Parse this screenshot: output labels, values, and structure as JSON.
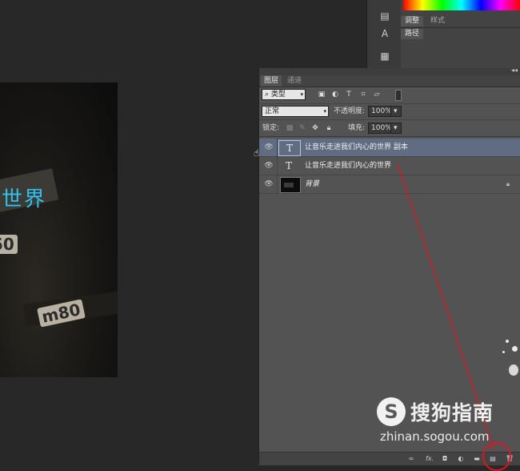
{
  "canvas": {
    "text": "世界",
    "tag_left": "50",
    "tag_right": "m80"
  },
  "top_panel": {
    "tabs": [
      "调整",
      "样式"
    ],
    "path_tab": "路径"
  },
  "layers_panel": {
    "tabs": [
      "图层",
      "通道"
    ],
    "filter": {
      "label": "类型",
      "icons": [
        "image-filter-icon",
        "adjustment-filter-icon",
        "type-filter-icon",
        "shape-filter-icon",
        "smart-object-filter-icon"
      ]
    },
    "blend_mode": "正常",
    "opacity": {
      "label": "不透明度:",
      "value": "100%"
    },
    "lock": {
      "label": "锁定:",
      "icons": [
        "lock-transparent-icon",
        "lock-pixels-icon",
        "lock-position-icon",
        "lock-all-icon"
      ]
    },
    "fill": {
      "label": "填充:",
      "value": "100%"
    },
    "layers": [
      {
        "name": "让音乐走进我们内心的世界 副本",
        "type": "text",
        "selected": true
      },
      {
        "name": "让音乐走进我们内心的世界",
        "type": "text",
        "selected": false
      },
      {
        "name": "背景",
        "type": "image",
        "selected": false,
        "locked": true
      }
    ],
    "bottom_icons": [
      "link-icon",
      "fx-icon",
      "mask-icon",
      "adjustment-icon",
      "folder-icon",
      "new-layer-icon",
      "trash-icon"
    ],
    "fx_label": "fx."
  },
  "watermark": {
    "brand": "搜狗指南",
    "url": "zhinan.sogou.com"
  },
  "colors": {
    "background": "#282828",
    "panel": "#535353",
    "selected_row": "#5f6c82",
    "canvas_text": "#2ec2ee",
    "annotation_red": "#e0141e"
  }
}
